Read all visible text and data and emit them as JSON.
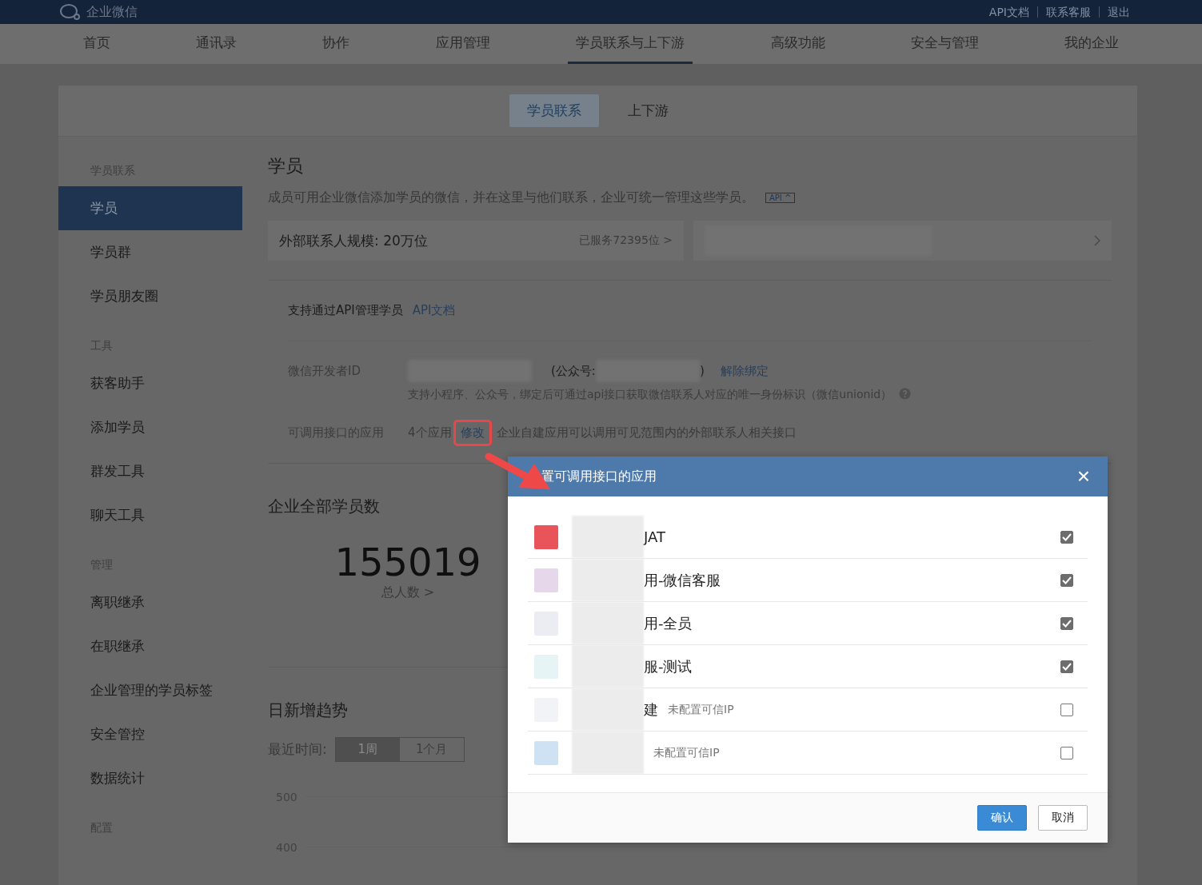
{
  "topbar": {
    "logo": "企业微信",
    "links": [
      "API文档",
      "联系客服",
      "退出"
    ]
  },
  "nav": [
    {
      "label": "首页",
      "selected": false
    },
    {
      "label": "通讯录",
      "selected": false
    },
    {
      "label": "协作",
      "selected": false
    },
    {
      "label": "应用管理",
      "selected": false
    },
    {
      "label": "学员联系与上下游",
      "selected": true
    },
    {
      "label": "高级功能",
      "selected": false
    },
    {
      "label": "安全与管理",
      "selected": false
    },
    {
      "label": "我的企业",
      "selected": false
    }
  ],
  "subtabs": [
    {
      "label": "学员联系",
      "selected": true
    },
    {
      "label": "上下游",
      "selected": false
    }
  ],
  "sidebar": [
    {
      "title": "学员联系",
      "items": [
        {
          "label": "学员",
          "selected": true
        },
        {
          "label": "学员群",
          "selected": false
        },
        {
          "label": "学员朋友圈",
          "selected": false
        }
      ]
    },
    {
      "title": "工具",
      "items": [
        {
          "label": "获客助手",
          "selected": false
        },
        {
          "label": "添加学员",
          "selected": false
        },
        {
          "label": "群发工具",
          "selected": false
        },
        {
          "label": "聊天工具",
          "selected": false
        }
      ]
    },
    {
      "title": "管理",
      "items": [
        {
          "label": "离职继承",
          "selected": false
        },
        {
          "label": "在职继承",
          "selected": false
        },
        {
          "label": "企业管理的学员标签",
          "selected": false
        },
        {
          "label": "安全管控",
          "selected": false
        },
        {
          "label": "数据统计",
          "selected": false
        }
      ]
    },
    {
      "title": "配置"
    }
  ],
  "main": {
    "title": "学员",
    "description": "成员可用企业微信添加学员的微信，并在这里与他们联系，企业可统一管理这些学员。",
    "api_badge": "API ^",
    "scale": {
      "label": "外部联系人规模: 20万位",
      "served": "已服务72395位",
      "chevron": ">"
    },
    "api": {
      "intro": "支持通过API管理学员",
      "link": "API文档",
      "developer_label": "微信开发者ID",
      "official_open": "(公众号:",
      "official_close": ")",
      "unbind": "解除绑定",
      "hint": "支持小程序、公众号，绑定后可通过api接口获取微信联系人对应的唯一身份标识（微信unionid）",
      "apps_label": "可调用接口的应用",
      "apps_count": "4个应用",
      "modify": "修改",
      "apps_note": "企业自建应用可以调用可见范围内的外部联系人相关接口"
    },
    "total": {
      "title": "企业全部学员数",
      "value": "155019",
      "caption": "总人数 >"
    },
    "trend": {
      "title": "日新增趋势",
      "range_label": "最近时间:",
      "ranges": [
        {
          "label": "1周",
          "selected": true
        },
        {
          "label": "1个月",
          "selected": false
        }
      ],
      "axis_labels": [
        "500",
        "400"
      ]
    }
  },
  "dialog": {
    "title": "置可调用接口的应用",
    "close": "×",
    "apps": [
      {
        "name": "JAT",
        "checked": true
      },
      {
        "name": "用-微信客服",
        "checked": true
      },
      {
        "name": "用-全员",
        "checked": true
      },
      {
        "name": "服-测试",
        "checked": true
      },
      {
        "name": "建",
        "note": "未配置可信IP",
        "checked": false
      },
      {
        "note": "未配置可信IP",
        "checked": false
      }
    ],
    "buttons": [
      {
        "label": "确认",
        "kind": "primary"
      },
      {
        "label": "取消",
        "kind": "secondary"
      }
    ]
  }
}
